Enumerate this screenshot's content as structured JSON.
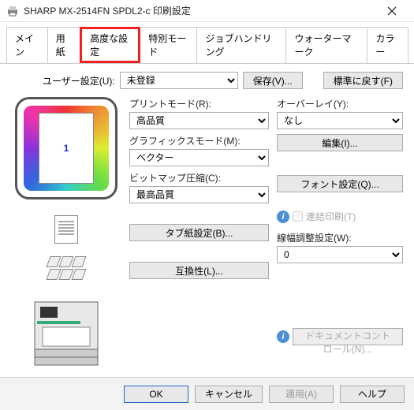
{
  "window": {
    "title": "SHARP MX-2514FN SPDL2-c 印刷設定"
  },
  "tabs": {
    "main": "メイン",
    "paper": "用紙",
    "advanced": "高度な設定",
    "special": "特別モード",
    "job": "ジョブハンドリング",
    "watermark": "ウォーターマーク",
    "color": "カラー"
  },
  "userset": {
    "label": "ユーザー設定(U):",
    "value": "未登録",
    "save": "保存(V)...",
    "defaults": "標準に戻す(F)"
  },
  "preview": {
    "pagenum": "1"
  },
  "mid": {
    "printmode_label": "プリントモード(R):",
    "printmode_value": "高品質",
    "graphics_label": "グラフィックスモード(M):",
    "graphics_value": "ベクター",
    "bitmap_label": "ビットマップ圧縮(C):",
    "bitmap_value": "最高品質",
    "tab_btn": "タブ紙設定(B)...",
    "compat_btn": "互換性(L)..."
  },
  "right": {
    "overlay_label": "オーバーレイ(Y):",
    "overlay_value": "なし",
    "edit_btn": "編集(I)...",
    "font_btn": "フォント設定(Q)...",
    "tandem_label": "連結印刷(T)",
    "linewidth_label": "線幅調整設定(W):",
    "linewidth_value": "0",
    "doc_control": "ドキュメントコントロール(N)..."
  },
  "footer": {
    "ok": "OK",
    "cancel": "キャンセル",
    "apply": "適用(A)",
    "help": "ヘルプ"
  }
}
